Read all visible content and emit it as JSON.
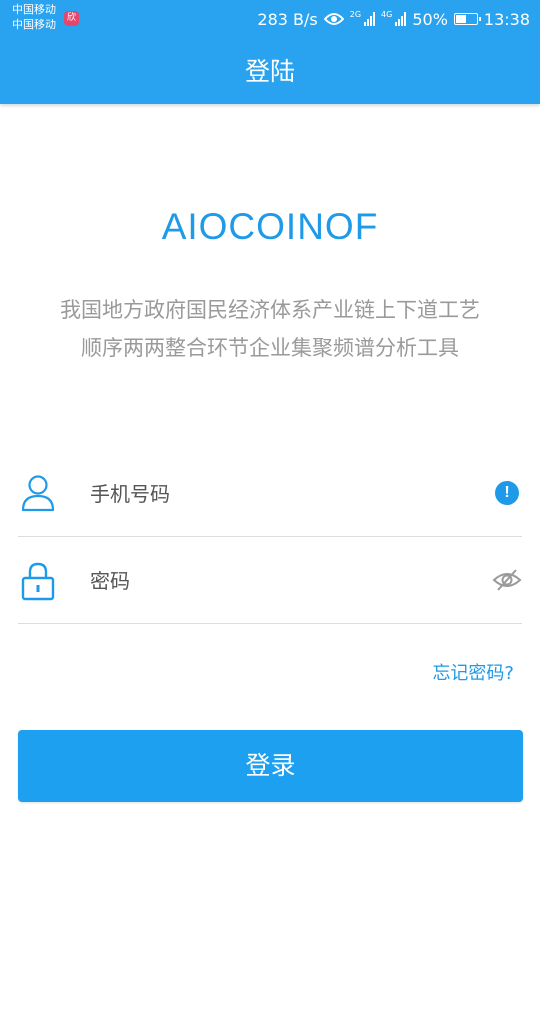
{
  "status_bar": {
    "carrier_line1": "中国移动",
    "carrier_line2": "中国移动",
    "carrier_badge": "欣",
    "net_speed": "283 B/s",
    "net_tag_1": "2G",
    "net_tag_2": "4G",
    "battery": "50%",
    "battery_level": 0.5,
    "time": "13:38",
    "color": "#29a3f0"
  },
  "app_bar": {
    "title": "登陆"
  },
  "brand": {
    "name": "AIOCOINOF",
    "tagline_line1": "我国地方政府国民经济体系产业链上下道工艺",
    "tagline_line2": "顺序两两整合环节企业集聚频谱分析工具"
  },
  "form": {
    "phone_placeholder": "手机号码",
    "password_placeholder": "密码",
    "alert_glyph": "!",
    "forgot_link": "忘记密码?",
    "login_button": "登录",
    "accent_color": "#1ea0f0"
  },
  "icons": [
    "user-icon",
    "info-icon",
    "lock-icon",
    "eye-hidden-icon",
    "eye-icon",
    "battery-icon"
  ]
}
